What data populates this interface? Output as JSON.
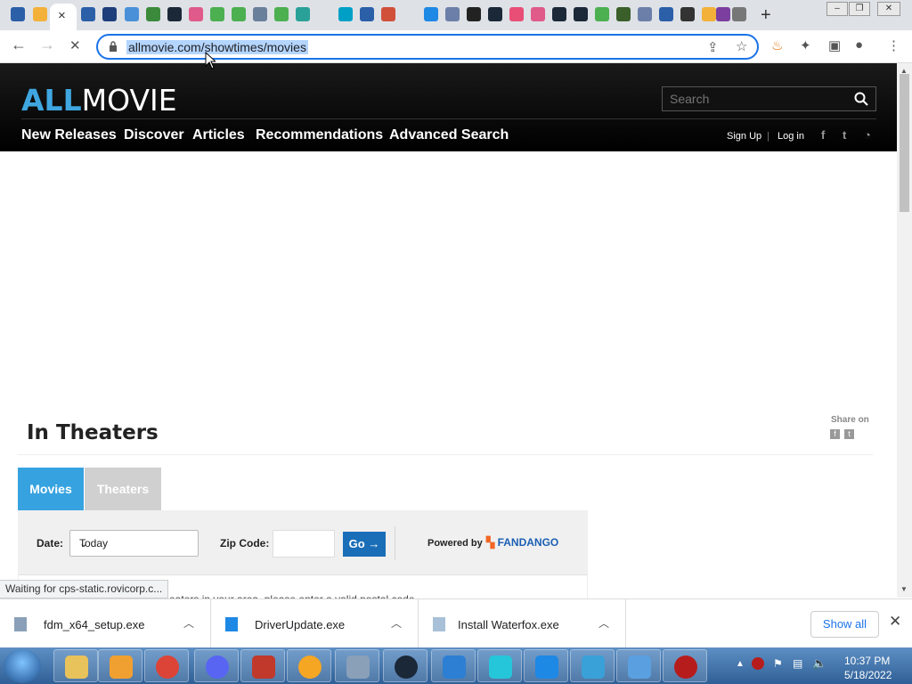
{
  "browser": {
    "url": "allmovie.com/showtimes/movies",
    "tab_close_glyph": "×",
    "new_tab_glyph": "+"
  },
  "site": {
    "logo_all": "ALL",
    "logo_movie": "MOVIE",
    "search_placeholder": "Search",
    "nav": [
      "New Releases",
      "Discover",
      "Articles",
      "Recommendations",
      "Advanced Search"
    ],
    "sign_up": "Sign Up",
    "separator": "|",
    "log_in": "Log in"
  },
  "content": {
    "page_title": "In Theaters",
    "share_label": "Share on",
    "tabs": [
      "Movies",
      "Theaters"
    ],
    "date_label": "Date:",
    "date_value": "Today",
    "zip_label": "Zip Code:",
    "zip_value": "",
    "go_label": "Go →",
    "powered_by": "Powered by",
    "fandango": "FANDANGO",
    "partial_text": "theaters in your area, please enter a valid postal code"
  },
  "status": {
    "text": "Waiting for cps-static.rovicorp.c..."
  },
  "downloads": {
    "items": [
      "fdm_x64_setup.exe",
      "DriverUpdate.exe",
      "Install Waterfox.exe"
    ],
    "show_all": "Show all"
  },
  "taskbar": {
    "time": "10:37 PM",
    "date": "5/18/2022"
  },
  "colors": {
    "accent": "#36a3e0",
    "go_button": "#1a6eb7",
    "logo_all": "#3fa6e0"
  }
}
